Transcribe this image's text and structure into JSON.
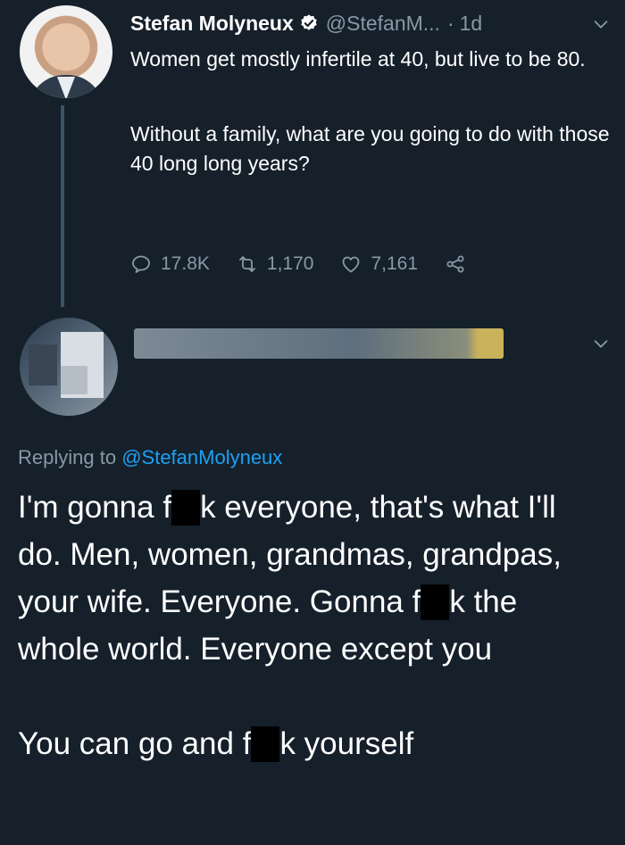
{
  "original_tweet": {
    "author_name": "Stefan Molyneux",
    "handle": "@StefanM...",
    "separator": "·",
    "time": "1d",
    "text_paragraph_1": "Women get mostly infertile at 40, but live to be 80.",
    "text_paragraph_2": "Without a family, what are you going to do with those 40 long long years?",
    "reply_count": "17.8K",
    "retweet_count": "1,170",
    "like_count": "7,161"
  },
  "reply_tweet": {
    "replying_to_prefix": "Replying to",
    "replying_to_mention": "@StefanMolyneux",
    "text_line_1a": "I'm gonna f",
    "text_line_1b": "k everyone, that's what I'll do. Men, women, grandmas, grandpas, your wife. Everyone. Gonna f",
    "text_line_1c": "k the whole world. Everyone except you",
    "text_line_2a": "You can go and f",
    "text_line_2b": "k yourself"
  },
  "colors": {
    "background": "#15202b",
    "text_primary": "#ffffff",
    "text_secondary": "#8899a6",
    "accent": "#1da1f2",
    "verified_badge": "#ffffff"
  },
  "icons": [
    "verified-icon",
    "chevron-down-icon",
    "reply-icon",
    "retweet-icon",
    "like-icon",
    "share-icon"
  ]
}
